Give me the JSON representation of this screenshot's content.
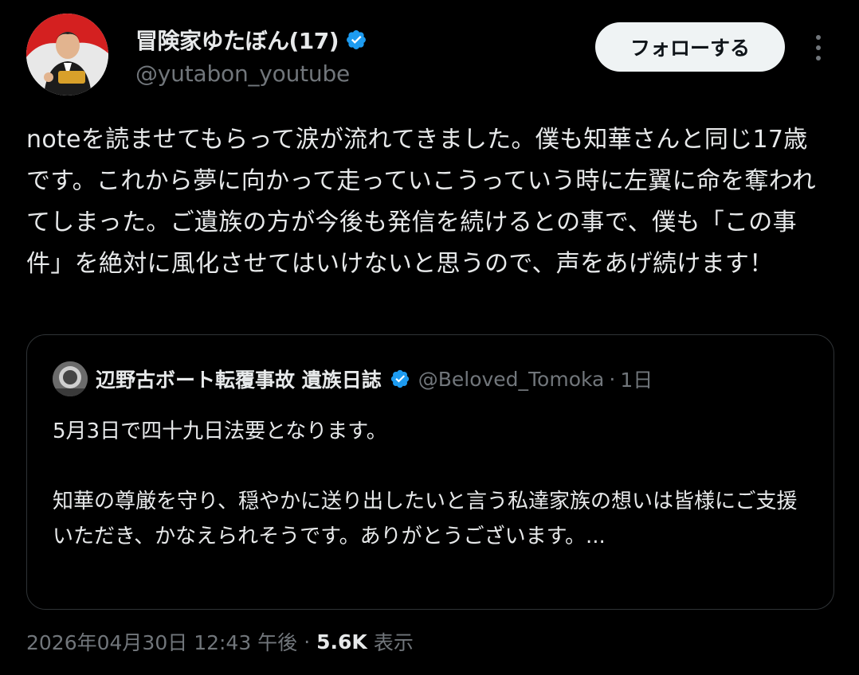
{
  "author": {
    "name": "冒険家ゆたぼん(17)",
    "handle": "@yutabon_youtube",
    "verified_color": "#1d9bf0"
  },
  "actions": {
    "follow_label": "フォローする",
    "more_icon": "more-vertical-icon"
  },
  "tweet": {
    "text": "noteを読ませてもらって涙が流れてきました。僕も知華さんと同じ17歳です。これから夢に向かって走っていこうっていう時に左翼に命を奪われてしまった。ご遺族の方が今後も発信を続けるとの事で、僕も「この事件」を絶対に風化させてはいけないと思うので、声をあげ続けます！"
  },
  "quote": {
    "name": "辺野古ボート転覆事故 遺族日誌",
    "handle": "@Beloved_Tomoka",
    "separator": "·",
    "time": "1日",
    "text": "5月3日で四十九日法要となります。\n\n知華の尊厳を守り、穏やかに送り出したいと言う私達家族の想いは皆様にご支援いただき、かなえられそうです。ありがとうございます。..."
  },
  "meta": {
    "timestamp": "2026年04月30日 12:43 午後",
    "separator": "·",
    "views_count": "5.6K",
    "views_label": "表示"
  }
}
